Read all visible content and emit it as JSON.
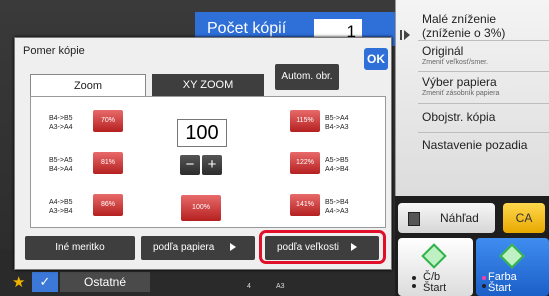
{
  "header": {
    "copies_label": "Počet kópií",
    "copies_value": "1"
  },
  "right_panel": {
    "items": [
      {
        "label": "Malé zníženie",
        "sub": "(zníženie o 3%)"
      },
      {
        "label": "Originál",
        "sub": "Zmeniť veľkosť/smer."
      },
      {
        "label": "Výber papiera",
        "sub": "Zmeniť zásobník papiera"
      },
      {
        "label": "Obojstr. kópia",
        "sub": ""
      },
      {
        "label": "Nastavenie pozadia",
        "sub": ""
      }
    ]
  },
  "preview_button": "Náhľad",
  "ca_button": "CA",
  "bw_start": {
    "line1": "Č/b",
    "line2": "Štart"
  },
  "color_start": {
    "line1": "Farba",
    "line2": "Štart"
  },
  "others_button": "Ostatné",
  "strip_labels": {
    "num": "4",
    "paper": "A3"
  },
  "dialog": {
    "title": "Pomer kópie",
    "ok": "OK",
    "tabs": [
      "Zoom",
      "XY ZOOM"
    ],
    "auto_button": "Autom. obr.",
    "value": "100",
    "minus": "−",
    "plus": "+",
    "left_presets": [
      {
        "top": "B4->B5",
        "bottom": "A3->A4",
        "pct": "70%"
      },
      {
        "top": "B5->A5",
        "bottom": "B4->A4",
        "pct": "81%"
      },
      {
        "top": "A4->B5",
        "bottom": "A3->B4",
        "pct": "86%"
      }
    ],
    "right_presets": [
      {
        "pct": "115%",
        "top": "B5->A4",
        "bottom": "B4->A3"
      },
      {
        "pct": "122%",
        "top": "A5->B5",
        "bottom": "A4->B4"
      },
      {
        "pct": "141%",
        "top": "B5->B4",
        "bottom": "A4->A3"
      }
    ],
    "btn_100": "100%",
    "other_ratio": "Iné meritko",
    "by_paper": "podľa papiera",
    "by_size": "podľa veľkosti"
  }
}
